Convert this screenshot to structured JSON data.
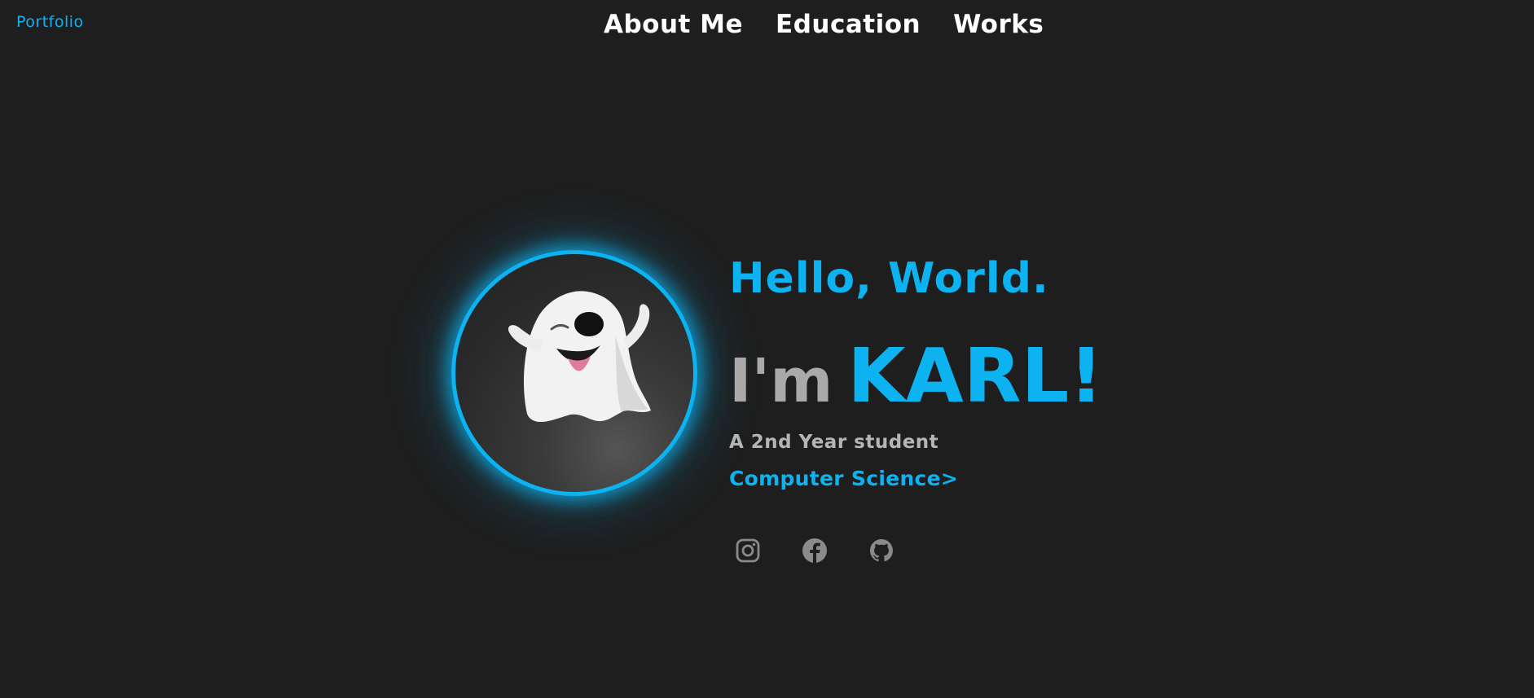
{
  "header": {
    "logo": "Portfolio",
    "nav": [
      {
        "label": "About Me"
      },
      {
        "label": "Education"
      },
      {
        "label": "Works"
      }
    ]
  },
  "hero": {
    "greeting": "Hello, World.",
    "intro_prefix": "I'm",
    "name": "KARL!",
    "subtitle": "A 2nd Year student",
    "course": "Computer Science>",
    "avatar_icon": "ghost-emoji"
  },
  "socials": [
    {
      "icon": "instagram-icon"
    },
    {
      "icon": "facebook-icon"
    },
    {
      "icon": "github-icon"
    }
  ],
  "colors": {
    "background": "#1e1e1e",
    "accent": "#0db2f0",
    "muted_text": "#a9a9a9",
    "icon_gray": "#8a8a8a"
  }
}
